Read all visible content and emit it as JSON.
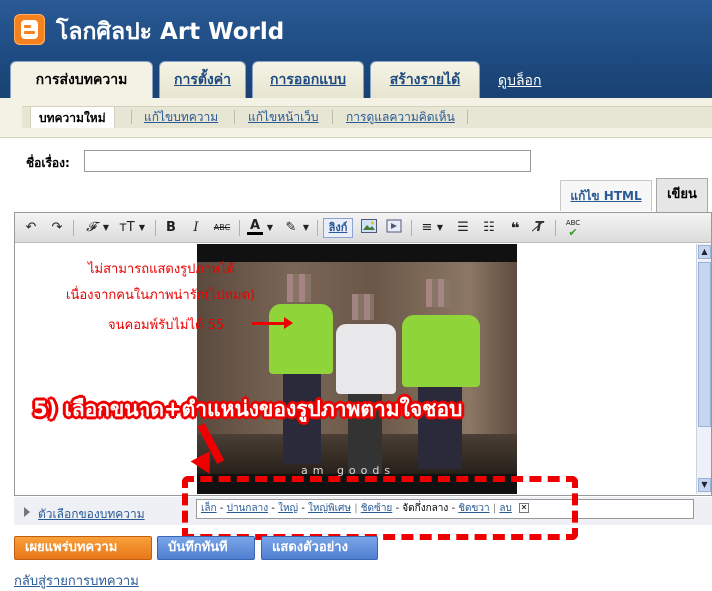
{
  "blog": {
    "title": "โลกศิลปะ Art World"
  },
  "tabs": [
    {
      "label": "การส่งบทความ",
      "active": true
    },
    {
      "label": "การตั้งค่า"
    },
    {
      "label": "การออกแบบ"
    },
    {
      "label": "สร้างรายได้"
    }
  ],
  "view_blog": "ดูบล็อก",
  "subtabs": [
    {
      "label": "บทความใหม่",
      "active": true
    },
    {
      "label": "แก้ไขบทความ"
    },
    {
      "label": "แก้ไขหน้าเว็บ"
    },
    {
      "label": "การดูแลความคิดเห็น"
    }
  ],
  "post_title": {
    "label": "ชื่อเรื่อง:",
    "value": ""
  },
  "mode_tabs": {
    "html": "แก้ไข HTML",
    "compose": "เขียน"
  },
  "toolbar": {
    "undo": "↶",
    "redo": "↷",
    "font": "𝓕",
    "size": "тT",
    "bold": "B",
    "italic": "I",
    "strike": "ABC",
    "text_color": "A",
    "link": "ลิงก์",
    "spell": "ABC"
  },
  "notes": {
    "line1": "ไม่สามารถแสดงรูปภาพได้",
    "line2": "เนื่องจากคนในภาพน่ารัก(ไปหมด)",
    "line3": "จนคอมพ์รับไม่ได้ 55",
    "callout": "5) เลือกขนาด+ตำแหน่งของรูปภาพตามใจชอบ",
    "watermark": "am goods"
  },
  "image_options": {
    "small": "เล็ก",
    "medium": "ปานกลาง",
    "large": "ใหญ่",
    "xlarge": "ใหญ่พิเศษ",
    "left": "ชิดซ้าย",
    "center": "จัดกึ่งกลาง",
    "right": "ชิดขวา",
    "remove": "ลบ",
    "sep_dash": "-",
    "sep_bar": "|",
    "close": "✕"
  },
  "post_options": "ตัวเลือกของบทความ",
  "buttons": {
    "publish": "เผยแพร่บทความ",
    "save": "บันทึกทันที",
    "preview": "แสดงตัวอย่าง"
  },
  "back_link": "กลับสู่รายการบทความ"
}
